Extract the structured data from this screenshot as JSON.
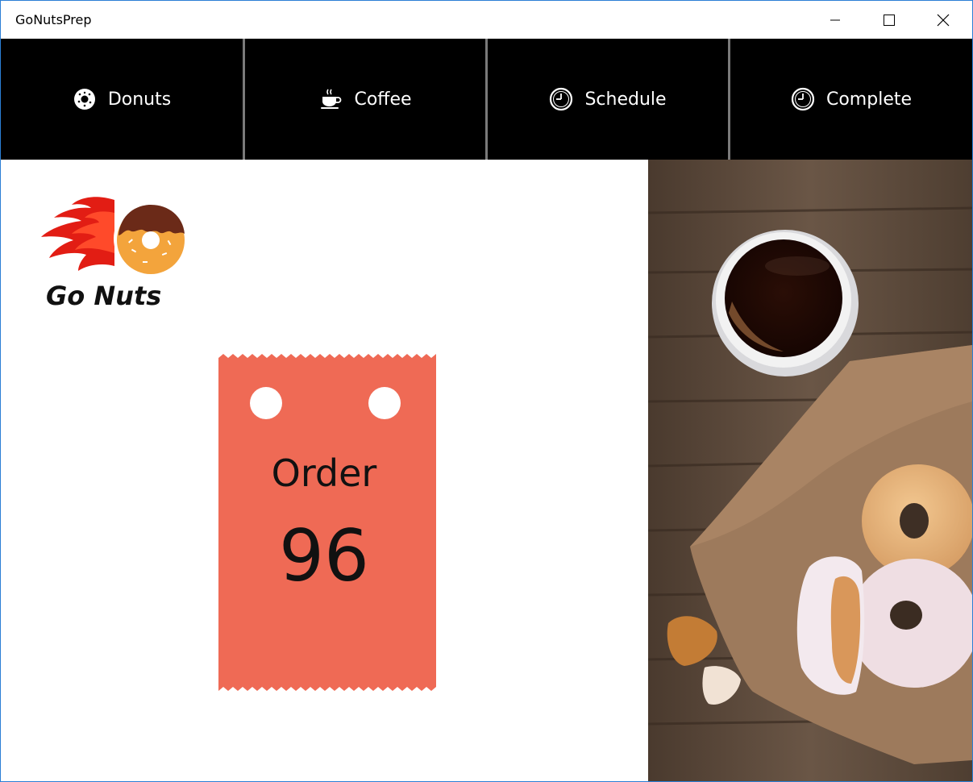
{
  "window": {
    "title": "GoNutsPrep"
  },
  "nav": {
    "items": [
      {
        "label": "Donuts",
        "icon": "donut-icon"
      },
      {
        "label": "Coffee",
        "icon": "coffee-cup-icon"
      },
      {
        "label": "Schedule",
        "icon": "clock-icon"
      },
      {
        "label": "Complete",
        "icon": "clock-icon"
      }
    ]
  },
  "logo": {
    "text": "Go Nuts"
  },
  "ticket": {
    "heading": "Order",
    "number": "96",
    "color": "#ef6a55"
  },
  "colors": {
    "nav_bg": "#000000",
    "nav_text": "#ffffff",
    "window_border": "#2b7fd6",
    "wood": "#5d4838"
  }
}
